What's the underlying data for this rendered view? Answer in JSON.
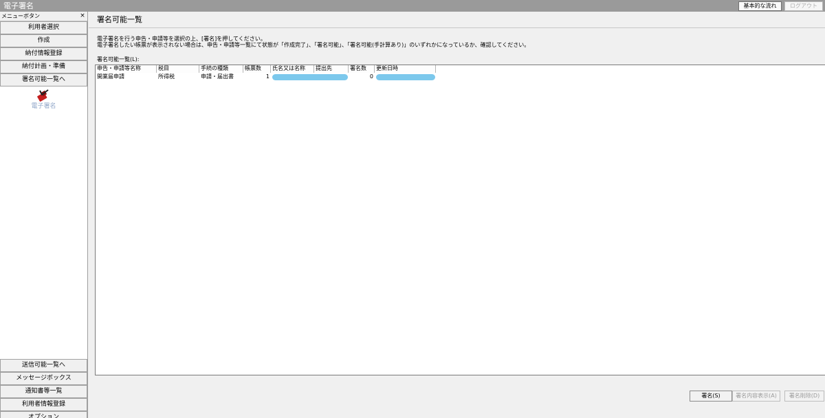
{
  "window": {
    "title": "電子署名",
    "basic_flow_button": "基本的な流れ",
    "logout_button": "ログアウト"
  },
  "sidebar": {
    "menu_label": "メニューボタン",
    "close_glyph": "×",
    "top_items": [
      {
        "label": "利用者選択"
      },
      {
        "label": "作成"
      },
      {
        "label": "納付情報登録"
      },
      {
        "label": "納付計画・準備"
      },
      {
        "label": "署名可能一覧へ"
      }
    ],
    "active_tool": {
      "label": "電子署名",
      "icon": "signature-stamp-icon"
    },
    "bottom_items": [
      {
        "label": "送信可能一覧へ"
      },
      {
        "label": "メッセージボックス"
      },
      {
        "label": "通知書等一覧"
      },
      {
        "label": "利用者情報登録"
      },
      {
        "label": "オプション"
      }
    ]
  },
  "main": {
    "page_title": "署名可能一覧",
    "instruction_line1": "電子署名を行う申告・申請等を選択の上、[署名]を押してください。",
    "instruction_line2": "電子署名したい帳票が表示されない場合は、申告・申請等一覧にて状態が「作成完了」、「署名可能」、「署名可能(手計算あり)」のいずれかになっているか、確認してください。",
    "list_label": "署名可能一覧(L):",
    "table": {
      "columns": [
        "申告・申請等名称",
        "税目",
        "手続の種類",
        "帳票数",
        "氏名又は名称",
        "提出先",
        "署名数",
        "更新日時"
      ],
      "rows": [
        {
          "name": "開業届申請",
          "tax": "所得税",
          "procedure": "申請・届出書",
          "form_count": "1",
          "signer": "",
          "submit_to": "",
          "sign_count": "0",
          "updated": ""
        }
      ]
    },
    "buttons": {
      "sign": "署名(S)",
      "view": "署名内容表示(A)",
      "delete": "署名削除(D)"
    }
  },
  "colors": {
    "titlebar": "#9a9a9a",
    "redaction": "#7cc8ec"
  }
}
